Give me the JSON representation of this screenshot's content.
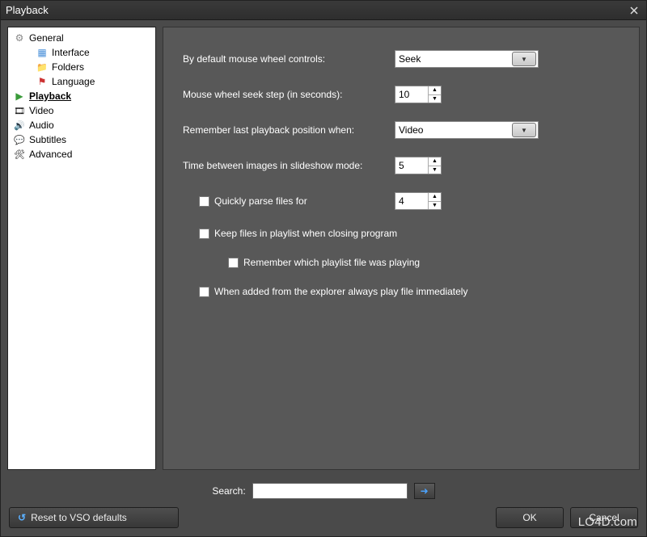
{
  "window": {
    "title": "Playback"
  },
  "sidebar": {
    "items": [
      {
        "label": "General",
        "icon": "gear",
        "root": true
      },
      {
        "label": "Interface",
        "icon": "window",
        "child": true
      },
      {
        "label": "Folders",
        "icon": "folder",
        "child": true
      },
      {
        "label": "Language",
        "icon": "flag",
        "child": true
      },
      {
        "label": "Playback",
        "icon": "play",
        "root": true,
        "selected": true
      },
      {
        "label": "Video",
        "icon": "video",
        "root": true
      },
      {
        "label": "Audio",
        "icon": "audio",
        "root": true
      },
      {
        "label": "Subtitles",
        "icon": "subtitles",
        "root": true
      },
      {
        "label": "Advanced",
        "icon": "advanced",
        "root": true
      }
    ]
  },
  "settings": {
    "mouse_wheel_label": "By default mouse wheel controls:",
    "mouse_wheel_value": "Seek",
    "seek_step_label": "Mouse wheel seek step (in seconds):",
    "seek_step_value": "10",
    "remember_pos_label": "Remember last playback position when:",
    "remember_pos_value": "Video",
    "slideshow_label": "Time between images in slideshow mode:",
    "slideshow_value": "5",
    "quick_parse_label": "Quickly parse files for",
    "quick_parse_value": "4",
    "keep_playlist_label": "Keep files in playlist when closing program",
    "remember_playlist_label": "Remember which playlist file was playing",
    "explorer_play_label": "When added from the explorer always play file immediately"
  },
  "search": {
    "label": "Search:"
  },
  "footer": {
    "reset_label": "Reset to VSO defaults",
    "ok_label": "OK",
    "cancel_label": "Cancel"
  },
  "watermark": "LO4D.com"
}
